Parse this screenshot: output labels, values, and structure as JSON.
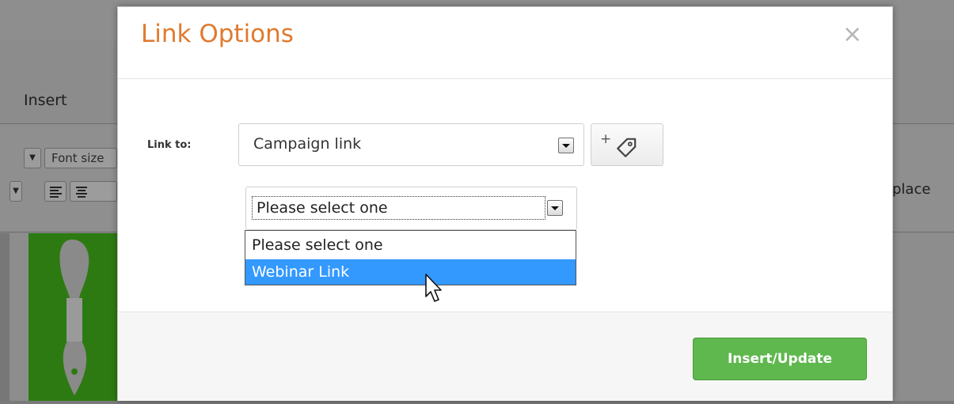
{
  "background_editor": {
    "menu_insert": "Insert",
    "toolbar_font_size": "Font size",
    "toolbar_replace": "place"
  },
  "modal": {
    "title": "Link Options",
    "close_glyph": "×",
    "link_to_label": "Link to:",
    "link_to_value": "Campaign link",
    "sub_select_value": "Please select one",
    "dropdown_options": [
      "Please select one",
      "Webinar Link"
    ],
    "selected_option": "Webinar Link",
    "tag_button_plus": "+",
    "primary_button": "Insert/Update"
  },
  "colors": {
    "title": "#e07a2f",
    "primary_button": "#5fb84e",
    "selected_option": "#3399ff",
    "overlay_green": "#2d7a12"
  },
  "icons": [
    "close-icon",
    "chevron-down-icon",
    "add-tag-icon",
    "align-left-icon",
    "align-center-icon",
    "mouse-pointer-icon"
  ]
}
